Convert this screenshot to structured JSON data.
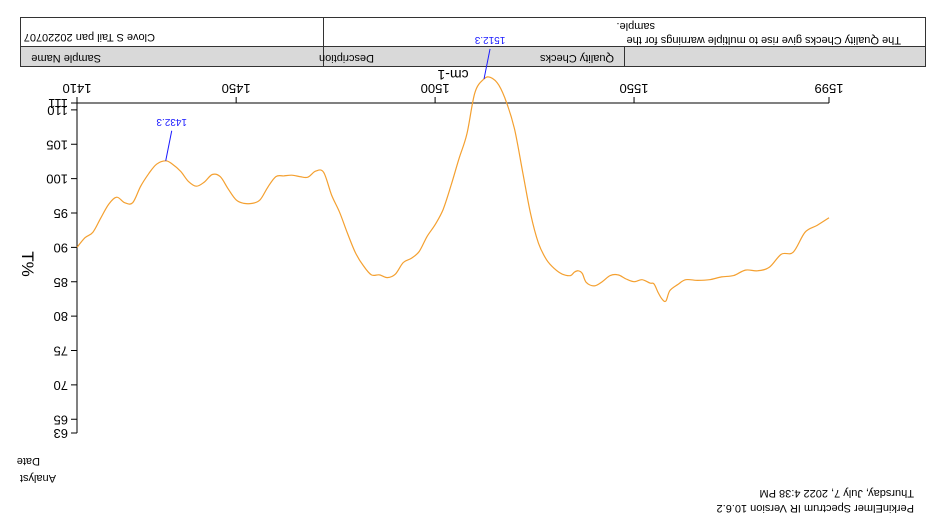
{
  "header": {
    "col1_label": "Sample Name",
    "col2_label": "Description",
    "col3_label": "Quality Checks",
    "sample_name": "Clove S Tail pan 20220707",
    "quality_line1": "The Quality Checks give rise to multiple warnings for the",
    "quality_line2": "sample."
  },
  "footer": {
    "date_label": "Date",
    "analyst_label": "Analyst",
    "timestamp": "Thursday, July 7, 2022 4:38 PM",
    "software": "PerkinElmer Spectrum IR Version 10.6.2"
  },
  "colors": {
    "trace": "#f4a030",
    "annotation": "#1a1aff"
  },
  "chart_data": {
    "type": "line",
    "xlabel": "cm-1",
    "ylabel": "T%",
    "xlim": [
      1599,
      1410
    ],
    "ylim": [
      63,
      111
    ],
    "x_ticks": [
      1599,
      1550,
      1500,
      1450,
      1410
    ],
    "y_ticks": [
      63,
      65,
      70,
      75,
      80,
      85,
      90,
      95,
      100,
      105,
      110,
      111
    ],
    "grid": false,
    "series": [
      {
        "x": [
          1599,
          1596,
          1593,
          1590,
          1587,
          1584,
          1581,
          1578,
          1575,
          1572,
          1569,
          1566,
          1563,
          1561,
          1559,
          1558,
          1557,
          1556,
          1555,
          1554,
          1552,
          1550,
          1548,
          1546,
          1544,
          1542,
          1540,
          1538,
          1537,
          1536,
          1535,
          1534,
          1532,
          1530,
          1528,
          1526,
          1524,
          1522,
          1520,
          1518,
          1516,
          1514,
          1512.3,
          1510,
          1508,
          1506,
          1504,
          1502,
          1500,
          1498,
          1496,
          1494,
          1492,
          1490,
          1488,
          1486,
          1484,
          1482,
          1480,
          1478,
          1476,
          1474,
          1472,
          1470,
          1468,
          1466,
          1464,
          1462,
          1460,
          1458,
          1456,
          1454,
          1452,
          1450,
          1448,
          1446,
          1444,
          1442,
          1440,
          1438,
          1436,
          1434,
          1432.3,
          1430,
          1428,
          1426,
          1424,
          1422,
          1420,
          1418,
          1416,
          1414,
          1412,
          1410
        ],
        "y": [
          94.3,
          93.2,
          92.2,
          89.3,
          89.0,
          87.1,
          86.6,
          86.7,
          85.9,
          85.7,
          85.3,
          85.2,
          85.3,
          84.6,
          83.7,
          82.2,
          82.5,
          83.5,
          84.7,
          84.8,
          85.3,
          85.0,
          85.4,
          86.0,
          85.9,
          85.0,
          84.4,
          84.9,
          86.2,
          86.6,
          86.4,
          85.9,
          86.1,
          86.9,
          88.2,
          90.6,
          94.9,
          101.0,
          107.1,
          111.0,
          113.6,
          114.7,
          114.5,
          112.5,
          106.5,
          102.9,
          99.0,
          95.5,
          93.3,
          91.6,
          89.4,
          88.4,
          87.8,
          86.1,
          85.6,
          86.0,
          86.0,
          87.3,
          89.2,
          92.0,
          95.1,
          97.6,
          100.9,
          101.1,
          100.2,
          100.3,
          100.5,
          100.4,
          100.3,
          98.8,
          96.9,
          96.4,
          96.4,
          96.9,
          98.5,
          100.3,
          100.6,
          99.5,
          98.9,
          99.6,
          101.1,
          102.1,
          102.6,
          102.1,
          100.7,
          98.9,
          96.5,
          96.5,
          97.3,
          96.3,
          94.3,
          92.2,
          91.4,
          90.0
        ]
      }
    ],
    "annotations": [
      {
        "x": 1512.3,
        "y": 114.5,
        "label": "1512.3"
      },
      {
        "x": 1432.3,
        "y": 102.6,
        "label": "1432.3"
      }
    ]
  }
}
